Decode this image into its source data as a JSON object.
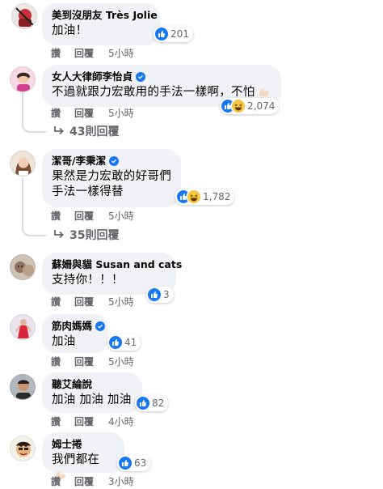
{
  "comments": [
    {
      "name": "美到沒朋友 Très Jolie",
      "text": "加油！",
      "reactions": {
        "icons": [
          "like"
        ],
        "count": "201"
      },
      "actions": {
        "like": "讚",
        "reply": "回覆",
        "time": "5小時"
      }
    },
    {
      "name": "女人大律師李怡貞",
      "verified": true,
      "text": "不過就跟力宏敢用的手法一樣啊，不怕",
      "text_emoji": "flexed-biceps-icon",
      "reactions": {
        "icons": [
          "like",
          "haha"
        ],
        "count": "2,074"
      },
      "actions": {
        "like": "讚",
        "reply": "回覆",
        "time": "5小時"
      },
      "replies": "43則回覆"
    },
    {
      "name": "潔哥/李秉潔",
      "verified": true,
      "text_lines": [
        "果然是力宏敢的好哥們",
        "手法一樣得替"
      ],
      "reactions": {
        "icons": [
          "like",
          "haha"
        ],
        "count": "1,782"
      },
      "actions": {
        "like": "讚",
        "reply": "回覆",
        "time": "5小時"
      },
      "replies": "35則回覆"
    },
    {
      "name": "蘇姍與貓 Susan and cats",
      "text": "支持你！！！",
      "reactions": {
        "icons": [
          "like"
        ],
        "count": "3"
      },
      "actions": {
        "like": "讚",
        "reply": "回覆",
        "time": "5小時"
      }
    },
    {
      "name": "筋肉媽媽",
      "verified": true,
      "text": "加油",
      "reactions": {
        "icons": [
          "like"
        ],
        "count": "41"
      },
      "actions": {
        "like": "讚",
        "reply": "回覆",
        "time": "5小時"
      }
    },
    {
      "name": "聽艾綸說",
      "text": "加油 加油 加油",
      "reactions": {
        "icons": [
          "like"
        ],
        "count": "82"
      },
      "actions": {
        "like": "讚",
        "reply": "回覆",
        "time": "4小時"
      }
    },
    {
      "name": "姆士捲",
      "text": "我們都在",
      "text_emoji": "flexed-biceps-icon",
      "reactions": {
        "icons": [
          "like"
        ],
        "count": "63"
      },
      "actions": {
        "like": "讚",
        "reply": "回覆",
        "time": "3小時"
      }
    }
  ],
  "colors": {
    "like": "#1877f2",
    "haha": "#f7c53f",
    "bubble": "#f0f2f5",
    "secondary_text": "#65676b",
    "thread_line": "#d8dadf"
  }
}
